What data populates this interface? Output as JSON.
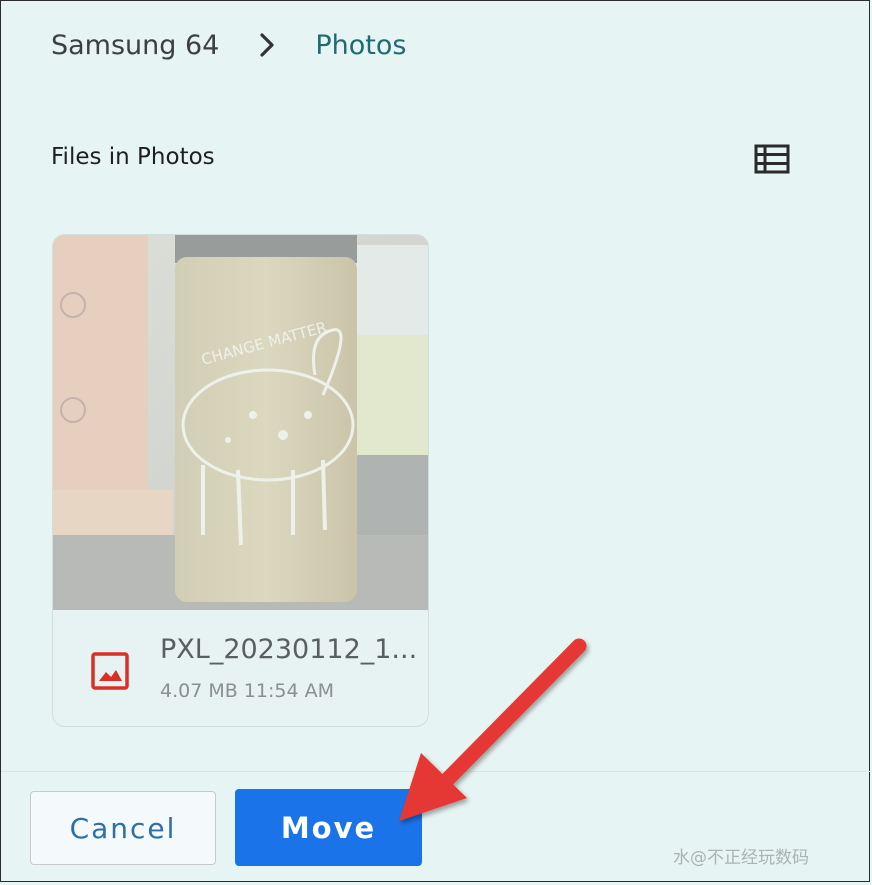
{
  "breadcrumb": {
    "root": "Samsung 64",
    "current": "Photos",
    "separator_icon": "chevron-right-icon"
  },
  "section": {
    "title": "Files in Photos",
    "view_toggle_icon": "list-view-icon"
  },
  "file": {
    "name": "PXL_20230112_1...",
    "meta": "4.07 MB 11:54 AM",
    "type_icon": "image-icon",
    "thumbnail_text": "CHANGE MATTER"
  },
  "actions": {
    "cancel_label": "Cancel",
    "move_label": "Move"
  },
  "watermark": "水@不正经玩数码",
  "colors": {
    "background": "#e6f4f3",
    "accent": "#1a73e8",
    "breadcrumb_current": "#1f6b72",
    "cancel_text": "#2f6fa5",
    "file_icon": "#d93025",
    "annotation_arrow": "#e53935"
  }
}
